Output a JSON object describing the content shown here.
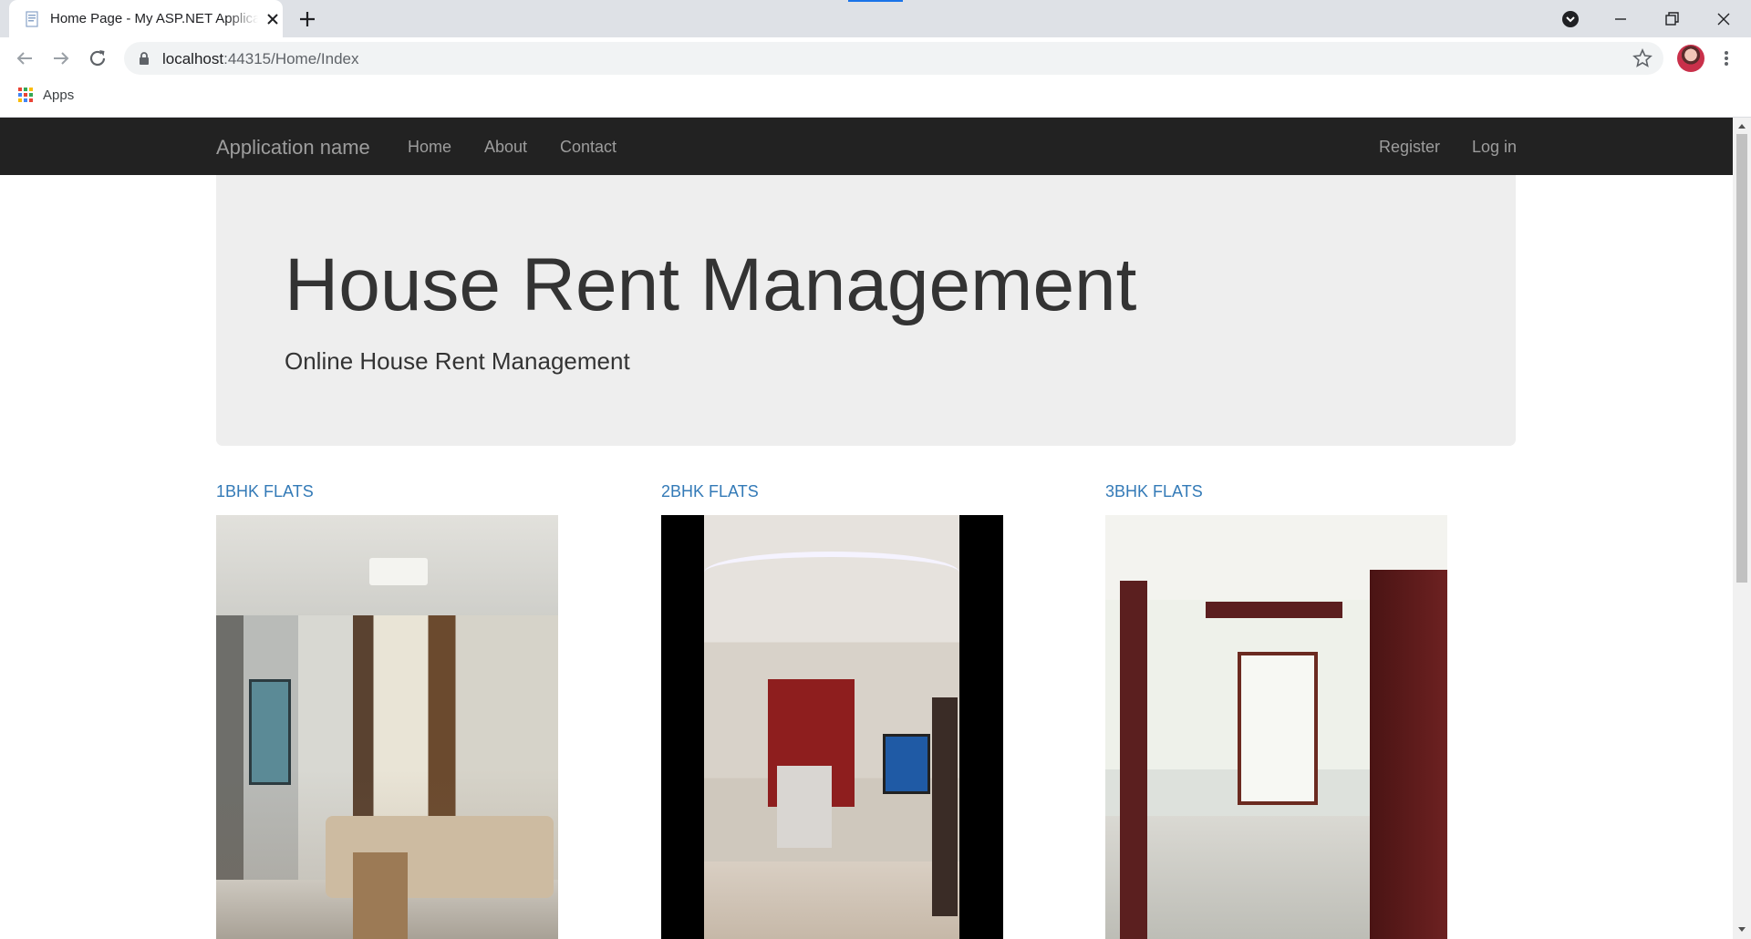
{
  "browser": {
    "tab_title": "Home Page - My ASP.NET Application",
    "url_host": "localhost",
    "url_rest": ":44315/Home/Index",
    "bookmarks_apps": "Apps"
  },
  "navbar": {
    "brand": "Application name",
    "links": [
      "Home",
      "About",
      "Contact"
    ],
    "right_links": [
      "Register",
      "Log in"
    ]
  },
  "jumbotron": {
    "title": "House Rent Management",
    "subtitle": "Online House Rent Management"
  },
  "flats": [
    {
      "label": "1BHK FLATS"
    },
    {
      "label": "2BHK FLATS"
    },
    {
      "label": "3BHK FLATS"
    }
  ],
  "colors": {
    "navbar_bg": "#222222",
    "navbar_text": "#9d9d9d",
    "jumbotron_bg": "#eeeeee",
    "link": "#337ab7"
  }
}
